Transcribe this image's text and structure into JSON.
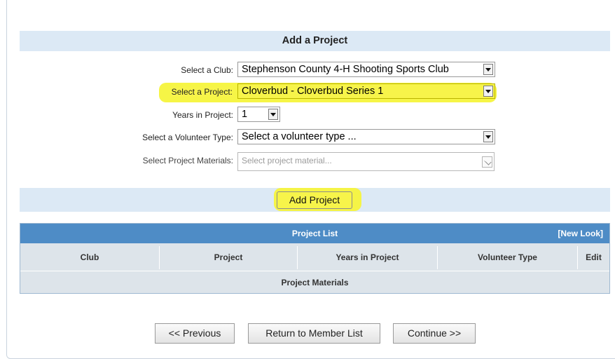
{
  "header": {
    "title": "Add a Project"
  },
  "form": {
    "club": {
      "label": "Select a Club:",
      "value": "Stephenson County 4-H Shooting Sports Club"
    },
    "project": {
      "label": "Select a Project:",
      "value": "Cloverbud - Cloverbud Series 1"
    },
    "years": {
      "label": "Years in Project:",
      "value": "1"
    },
    "volunteer": {
      "label": "Select a Volunteer Type:",
      "value": "Select a volunteer type ..."
    },
    "materials": {
      "label": "Select Project Materials:",
      "placeholder": "Select project material..."
    }
  },
  "add_button": {
    "label": "Add Project"
  },
  "project_list": {
    "title": "Project List",
    "new_look": "[New Look]",
    "columns": [
      "Club",
      "Project",
      "Years in Project",
      "Volunteer Type",
      "Edit"
    ],
    "materials_header": "Project Materials"
  },
  "nav": {
    "previous": "<< Previous",
    "return": "Return to Member List",
    "continue": "Continue >>"
  },
  "colors": {
    "highlight": "#f7f44a",
    "section_bg": "#dce9f5",
    "table_header": "#4e8cc6"
  }
}
